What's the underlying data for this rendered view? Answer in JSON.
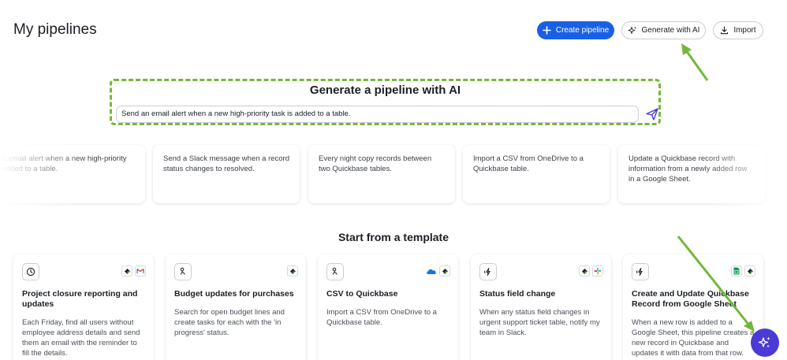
{
  "page": {
    "title": "My pipelines"
  },
  "header": {
    "create_label": "Create pipeline",
    "ai_label": "Generate with AI",
    "import_label": "Import"
  },
  "generator": {
    "title": "Generate a pipeline with AI",
    "input_value": "Send an email alert when a new high-priority task is added to a table."
  },
  "suggestions": [
    {
      "text": "Send an email alert when a new high-priority task is added to a table."
    },
    {
      "text": "Send a Slack message when a record status changes to resolved."
    },
    {
      "text": "Every night copy records between two Quickbase tables."
    },
    {
      "text": "Import a CSV from OneDrive to a Quickbase table."
    },
    {
      "text": "Update a Quickbase record with information from a newly added row in a Google Sheet."
    }
  ],
  "templates": {
    "heading": "Start from a template",
    "cards": [
      {
        "icon": "clock-icon",
        "apps": [
          "quickbase",
          "gmail"
        ],
        "title": "Project closure reporting and updates",
        "desc": "Each Friday, find all users without employee address details and send them an email with the reminder to fill the details."
      },
      {
        "icon": "pipeline-icon",
        "apps": [
          "quickbase"
        ],
        "title": "Budget updates for purchases",
        "desc": "Search for open budget lines and create tasks for each with the 'in progress' status."
      },
      {
        "icon": "pipeline-icon",
        "apps": [
          "onedrive",
          "quickbase"
        ],
        "title": "CSV to Quickbase",
        "desc": "Import a CSV from OneDrive to a Quickbase table."
      },
      {
        "icon": "bolt-icon",
        "apps": [
          "quickbase",
          "slack"
        ],
        "title": "Status field change",
        "desc": "When any status field changes in urgent support ticket table, notify my team in Slack."
      },
      {
        "icon": "bolt-icon",
        "apps": [
          "google-sheets",
          "quickbase"
        ],
        "title": "Create and Update Quickbase Record from Google Sheet",
        "desc": "When a new row is added to a Google Sheet, this pipeline creates a new record in Quickbase and updates it with data from that row."
      }
    ]
  },
  "colors": {
    "primary": "#1a60e6",
    "highlight": "#72b83e",
    "fab": "#4a3ad6",
    "send": "#4a3ad6"
  }
}
